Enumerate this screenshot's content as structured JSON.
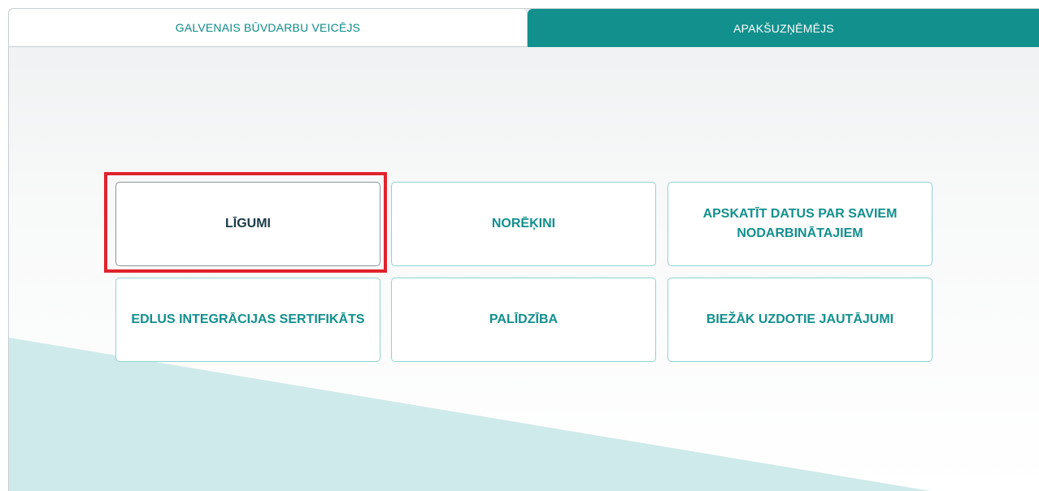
{
  "colors": {
    "accent": "#12908d",
    "tile_border": "#8fd4d1",
    "wave": "#cfeaea",
    "highlight": "#e0232d"
  },
  "tabs": [
    {
      "label": "GALVENAIS BŪVDARBU VEICĒJS",
      "active": true
    },
    {
      "label": "APAKŠUZŅĒMĒJS",
      "active": false
    }
  ],
  "tiles": [
    {
      "label": "LĪGUMI",
      "selected": true
    },
    {
      "label": "NORĒĶINI",
      "selected": false
    },
    {
      "label": "APSKATĪT DATUS PAR SAVIEM NODARBINĀTAJIEM",
      "selected": false
    },
    {
      "label": "EDLUS INTEGRĀCIJAS SERTIFIKĀTS",
      "selected": false
    },
    {
      "label": "PALĪDZĪBA",
      "selected": false
    },
    {
      "label": "BIEŽĀK UZDOTIE JAUTĀJUMI",
      "selected": false
    }
  ]
}
